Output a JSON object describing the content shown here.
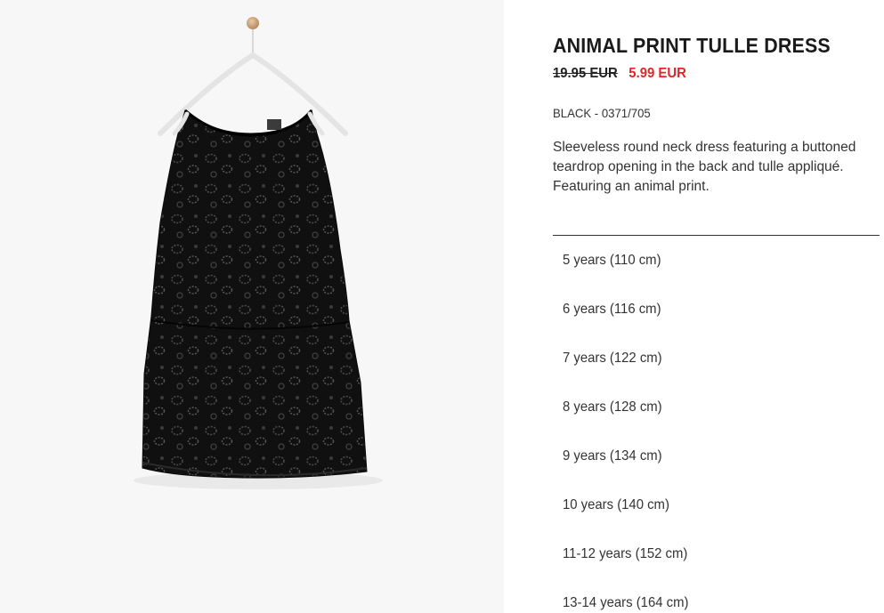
{
  "product": {
    "title": "ANIMAL PRINT TULLE DRESS",
    "old_price": "19.95 EUR",
    "sale_price": "5.99 EUR",
    "reference": "BLACK - 0371/705",
    "description": "Sleeveless round neck dress featuring a buttoned teardrop opening in the back and tulle appliqué. Featuring an animal print.",
    "image_alt": "black sleeveless animal print tulle dress on hanger"
  },
  "sizes": [
    {
      "label": "5 years (110 cm)"
    },
    {
      "label": "6 years (116 cm)"
    },
    {
      "label": "7 years (122 cm)"
    },
    {
      "label": "8 years (128 cm)"
    },
    {
      "label": "9 years (134 cm)"
    },
    {
      "label": "10 years (140 cm)"
    },
    {
      "label": "11-12 years (152 cm)"
    },
    {
      "label": "13-14 years (164 cm)"
    }
  ],
  "colors": {
    "sale": "#e0262b",
    "image_background": "#f7f7f7",
    "dress": "#111111"
  }
}
